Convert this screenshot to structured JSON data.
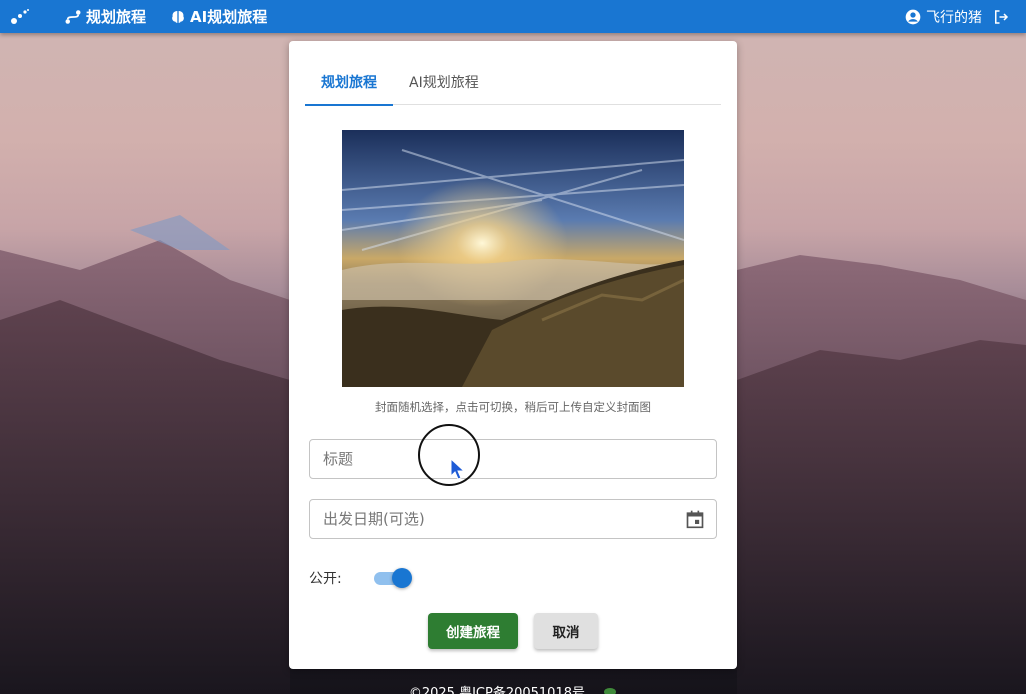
{
  "appbar": {
    "nav": [
      {
        "label": "规划旅程",
        "icon": "route-icon"
      },
      {
        "label": "AI规划旅程",
        "icon": "brain-icon"
      }
    ],
    "username": "飞行的猪"
  },
  "card": {
    "tabs": [
      {
        "label": "规划旅程",
        "active": true
      },
      {
        "label": "AI规划旅程",
        "active": false
      }
    ],
    "cover_hint": "封面随机选择，点击可切换，稍后可上传自定义封面图",
    "title_placeholder": "标题",
    "date_placeholder": "出发日期(可选)",
    "public_label": "公开:",
    "public_on": true,
    "create_label": "创建旅程",
    "cancel_label": "取消"
  },
  "footer": {
    "text": "©2025    粤ICP备20051018号"
  },
  "colors": {
    "primary": "#1976d2",
    "success": "#2e7d32"
  }
}
